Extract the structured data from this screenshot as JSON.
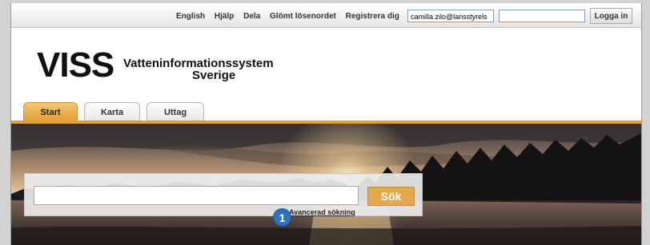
{
  "topbar": {
    "links": [
      "English",
      "Hjälp",
      "Dela",
      "Glömt lösenordet",
      "Registrera dig"
    ],
    "username_value": "camilla.zilo@lansstyrels",
    "password_value": "",
    "login_label": "Logga in"
  },
  "logo": {
    "title": "VISS",
    "subtitle_line1": "Vatteninformationssystem",
    "subtitle_line2": "Sverige"
  },
  "tabs": [
    {
      "label": "Start",
      "active": true
    },
    {
      "label": "Karta",
      "active": false
    },
    {
      "label": "Uttag",
      "active": false
    }
  ],
  "search": {
    "value": "",
    "button_label": "Sök",
    "advanced_link": "Avancerad sökning"
  },
  "annotation": {
    "badge": "1"
  },
  "colors": {
    "accent": "#e0a13b",
    "search_button": "#e6a84e",
    "badge": "#2f73bd"
  }
}
